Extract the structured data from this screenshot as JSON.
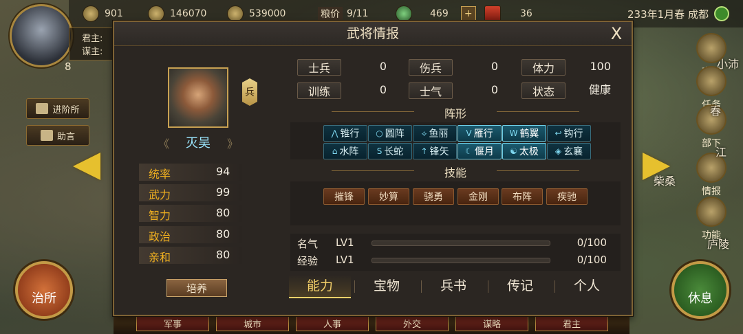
{
  "top_bar": {
    "food": "901",
    "gold": "146070",
    "troops": "539000",
    "grain_price_label": "粮价",
    "grain_price": "9/11",
    "gems": "469",
    "tokens": "36",
    "date": "233年1月春",
    "city": "成都"
  },
  "ruler": {
    "ruler_label": "君主:",
    "advisor_label": "谋主:",
    "level": "8"
  },
  "left_buttons": {
    "jinjie": "进阶所",
    "zhuyan": "助言"
  },
  "right_menu": [
    "商城",
    "任务",
    "部下",
    "情报",
    "功能"
  ],
  "map_labels": [
    "小沛",
    "春",
    "江",
    "柴桑",
    "庐陵"
  ],
  "big_buttons": {
    "left": "治所",
    "right": "休息"
  },
  "bottom_tabs": [
    "军事",
    "城市",
    "人事",
    "外交",
    "谋略",
    "君主"
  ],
  "dialog": {
    "title": "武将情报",
    "close": "X",
    "type_badge": "兵",
    "general_name": "灭吴",
    "name_chev_left": "《",
    "name_chev_right": "》",
    "stats": [
      {
        "label": "统率",
        "value": "94"
      },
      {
        "label": "武力",
        "value": "99"
      },
      {
        "label": "智力",
        "value": "80"
      },
      {
        "label": "政治",
        "value": "80"
      },
      {
        "label": "亲和",
        "value": "80"
      }
    ],
    "train_button": "培养",
    "info": [
      {
        "label": "士兵",
        "value": "0"
      },
      {
        "label": "伤兵",
        "value": "0"
      },
      {
        "label": "体力",
        "value": "100"
      },
      {
        "label": "训练",
        "value": "0"
      },
      {
        "label": "士气",
        "value": "0"
      },
      {
        "label": "状态",
        "value": "健康"
      }
    ],
    "formation_title": "阵形",
    "formations": [
      {
        "label": "锥行",
        "icon": "⋀",
        "active": false
      },
      {
        "label": "圆阵",
        "icon": "○",
        "active": false
      },
      {
        "label": "鱼丽",
        "icon": "⟡",
        "active": false
      },
      {
        "label": "雁行",
        "icon": "V",
        "active": true
      },
      {
        "label": "鹤翼",
        "icon": "W",
        "active": true
      },
      {
        "label": "钩行",
        "icon": "↩",
        "active": false
      },
      {
        "label": "水阵",
        "icon": "⌂",
        "active": false
      },
      {
        "label": "长蛇",
        "icon": "S",
        "active": false
      },
      {
        "label": "锋矢",
        "icon": "↑",
        "active": false
      },
      {
        "label": "偃月",
        "icon": "☾",
        "active": true
      },
      {
        "label": "太极",
        "icon": "☯",
        "active": true
      },
      {
        "label": "玄襄",
        "icon": "◈",
        "active": false
      }
    ],
    "skill_title": "技能",
    "skills": [
      "摧锋",
      "妙算",
      "骁勇",
      "金刚",
      "布阵",
      "疾驰"
    ],
    "fame": {
      "label": "名气",
      "level": "LV1",
      "value": "0/100",
      "progress": 0
    },
    "exp": {
      "label": "经验",
      "level": "LV1",
      "value": "0/100",
      "progress": 0
    },
    "tabs": [
      {
        "label": "能力",
        "active": true
      },
      {
        "label": "宝物",
        "active": false
      },
      {
        "label": "兵书",
        "active": false
      },
      {
        "label": "传记",
        "active": false
      },
      {
        "label": "个人",
        "active": false
      }
    ]
  },
  "colors": {
    "stat_label": "#f0b020",
    "name": "#9be7ff",
    "active_tab": "#f5d16a",
    "formation_on": "#6fd0e8"
  }
}
